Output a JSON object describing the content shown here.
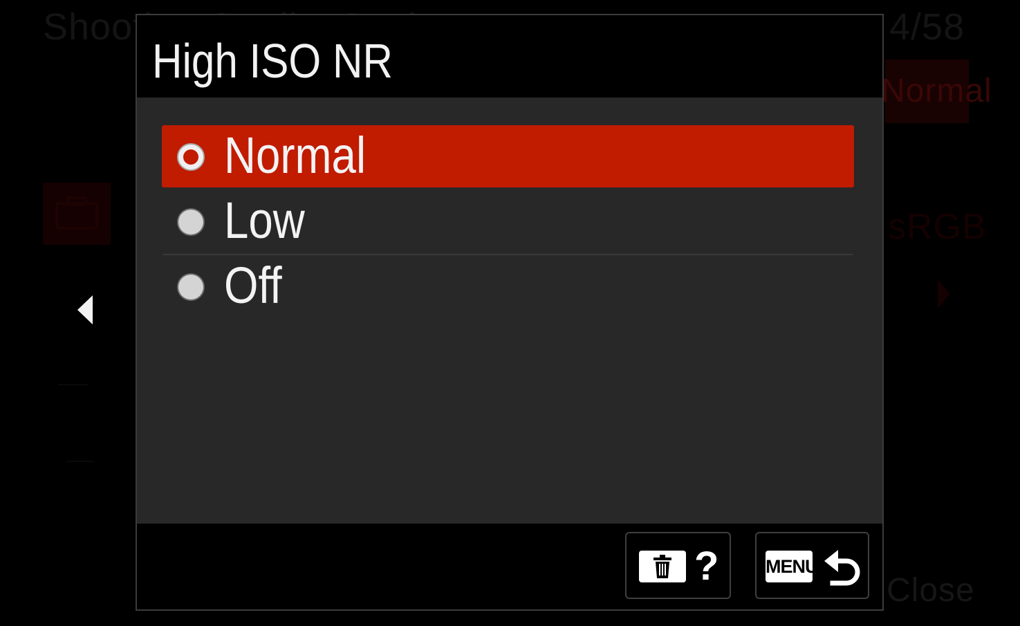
{
  "background_menu": {
    "title": "Shooting Quality Setting",
    "page_indicator": "4/58",
    "current_value": "Normal",
    "color_space_value": "sRGB",
    "footer_text": "Close"
  },
  "dialog": {
    "title": "High ISO NR",
    "options": [
      {
        "label": "Normal",
        "selected": true
      },
      {
        "label": "Low",
        "selected": false
      },
      {
        "label": "Off",
        "selected": false
      }
    ],
    "footer": {
      "help_glyph": "?",
      "menu_key_label": "MENU",
      "delete_icon": "trash-icon",
      "back_icon": "return-arrow-icon"
    }
  },
  "colors": {
    "selection": "#c11b00",
    "dialog_body": "#282828",
    "text": "#f3f3f3"
  }
}
